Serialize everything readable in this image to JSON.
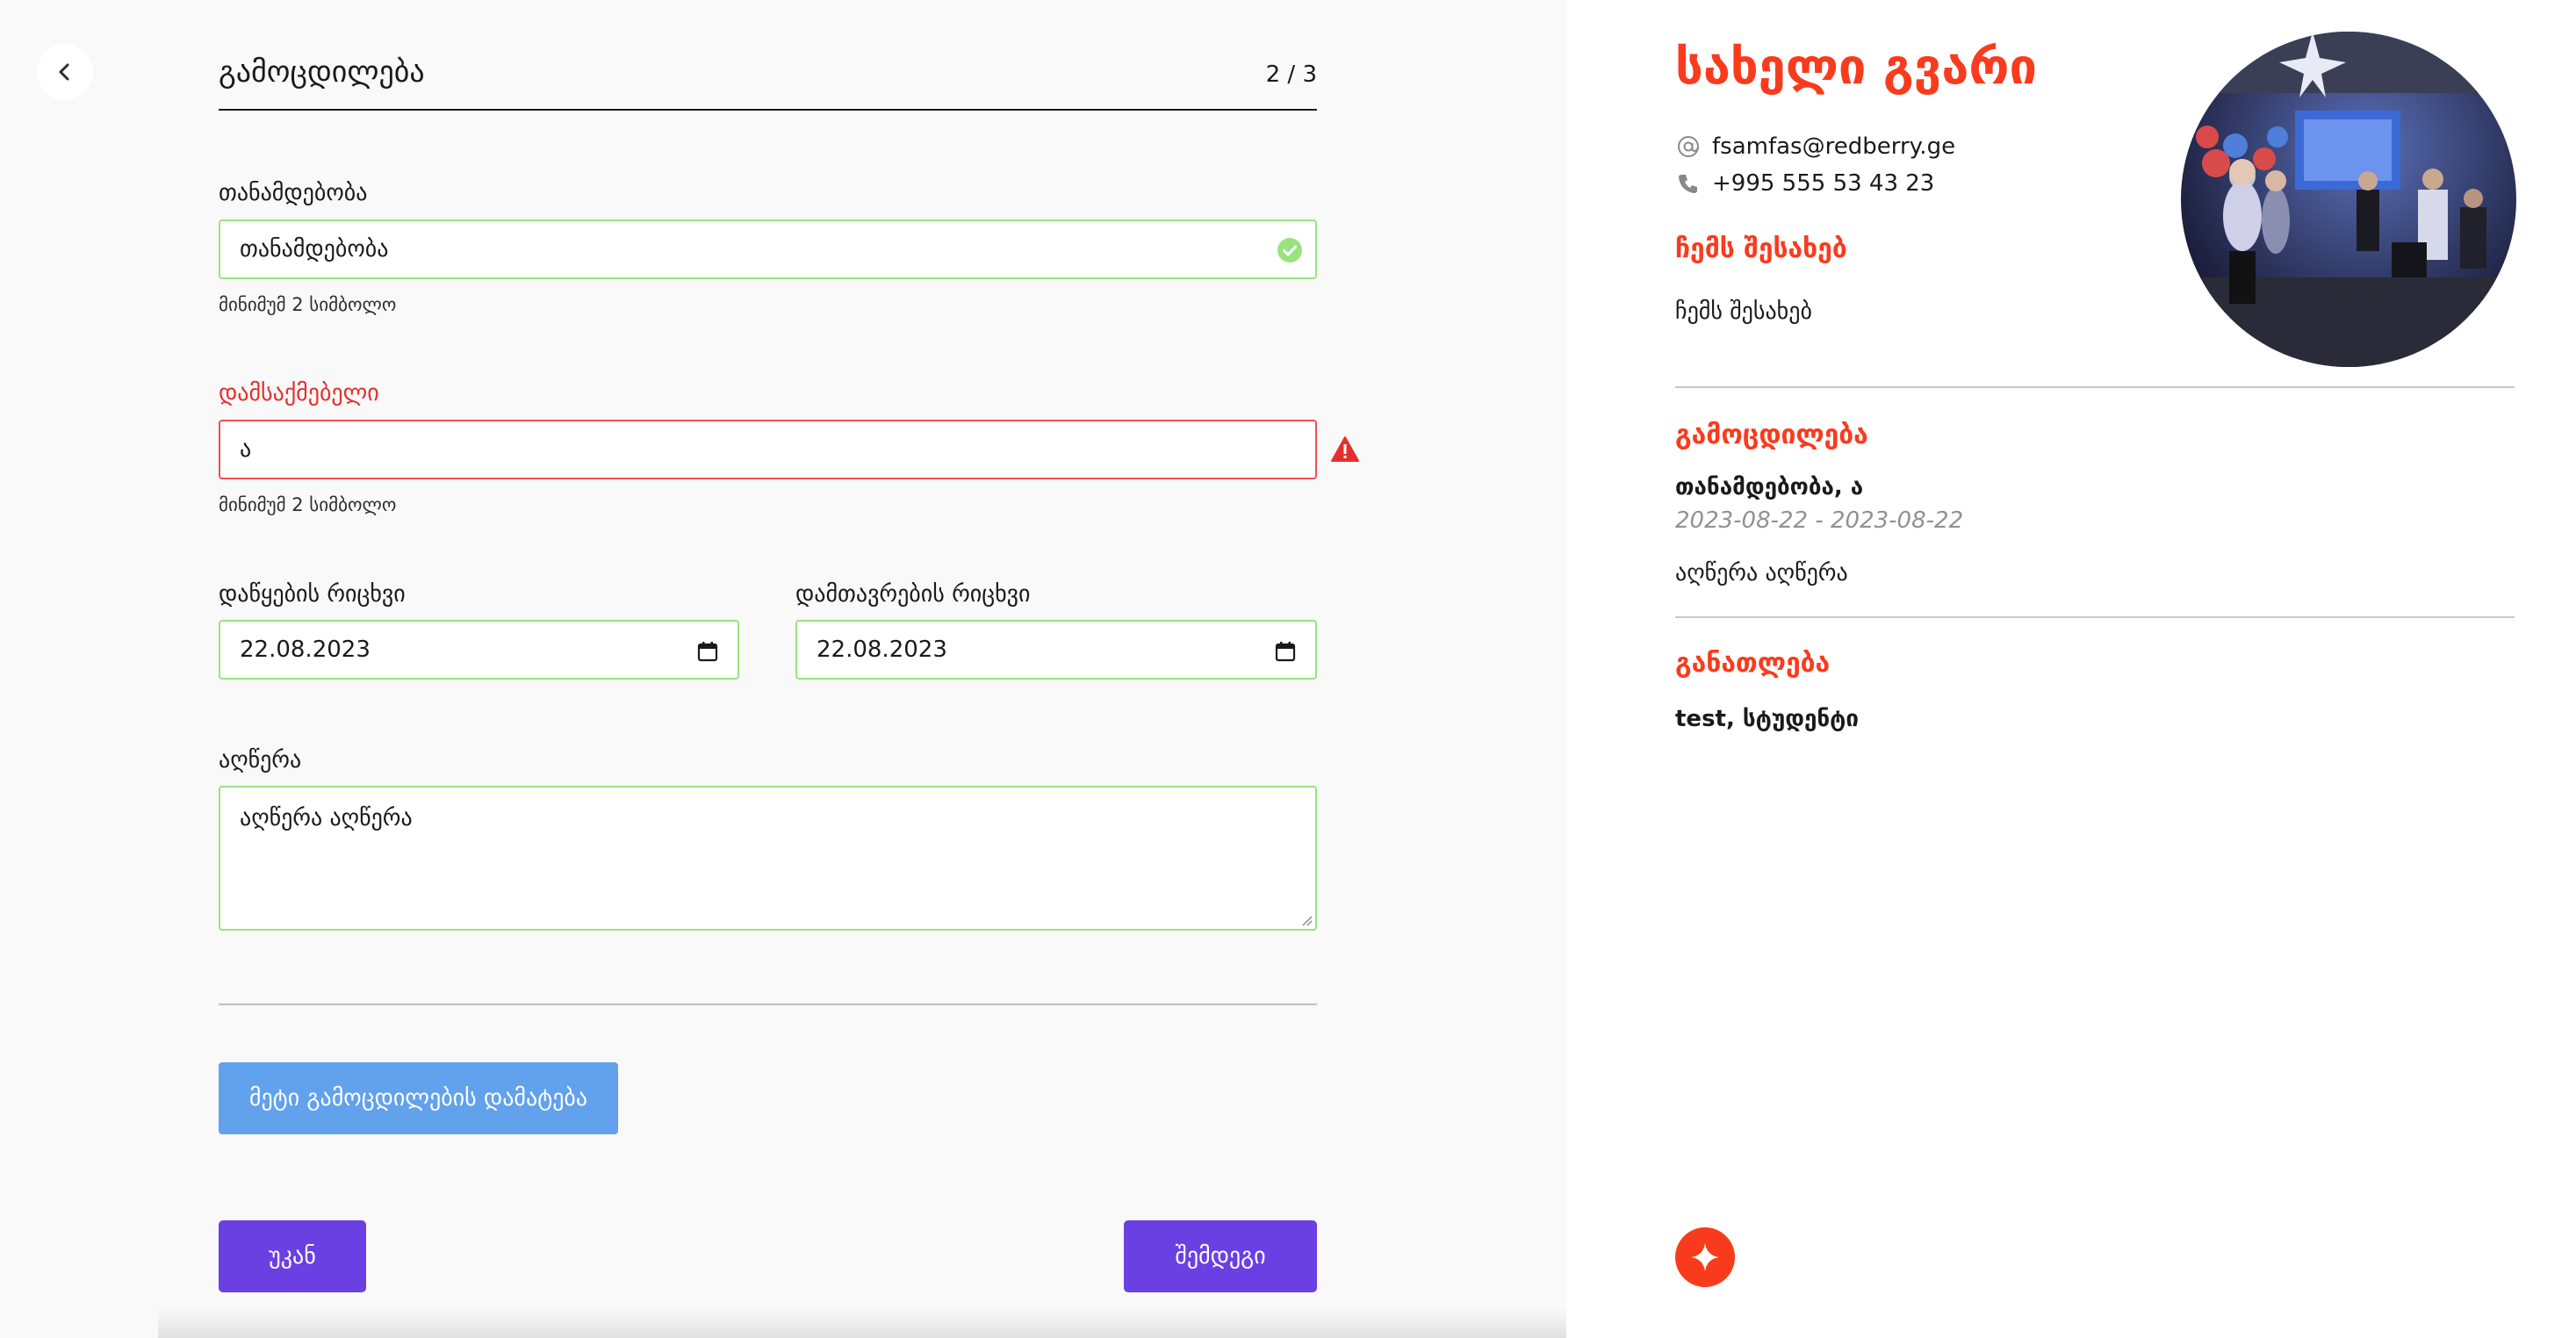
{
  "form": {
    "title": "გამოცდილება",
    "step": "2 / 3",
    "position": {
      "label": "თანამდებობა",
      "value": "თანამდებობა",
      "hint": "მინიმუმ 2 სიმბოლო",
      "state": "valid"
    },
    "employer": {
      "label": "დამსაქმებელი",
      "value": "ა",
      "hint": "მინიმუმ 2 სიმბოლო",
      "state": "error"
    },
    "start_date": {
      "label": "დაწყების რიცხვი",
      "value": "22.08.2023"
    },
    "end_date": {
      "label": "დამთავრების რიცხვი",
      "value": "22.08.2023"
    },
    "description": {
      "label": "აღწერა",
      "value": "აღწერა აღწერა"
    },
    "add_more_label": "მეტი გამოცდილების დამატება",
    "back_label": "უკან",
    "next_label": "შემდეგი"
  },
  "resume": {
    "name": "სახელი გვარი",
    "email": "fsamfas@redberry.ge",
    "phone": "+995 555 53 43 23",
    "about_title": "ჩემს შესახებ",
    "about_text": "ჩემს შესახებ",
    "experience_title": "გამოცდილება",
    "experience_heading": "თანამდებობა, ა",
    "experience_dates": "2023-08-22 - 2023-08-22",
    "experience_description": "აღწერა აღწერა",
    "education_title": "განათლება",
    "education_heading": "test, სტუდენტი"
  },
  "colors": {
    "accent_red": "#f93b1d",
    "valid_green": "#98e37e",
    "error_red": "#ef5050",
    "primary_purple": "#6b40e3",
    "add_blue": "#62a1eb"
  },
  "icons": [
    "chevron-left-icon",
    "check-circle-icon",
    "warning-icon",
    "calendar-icon",
    "at-icon",
    "phone-icon",
    "star-logo-icon"
  ]
}
